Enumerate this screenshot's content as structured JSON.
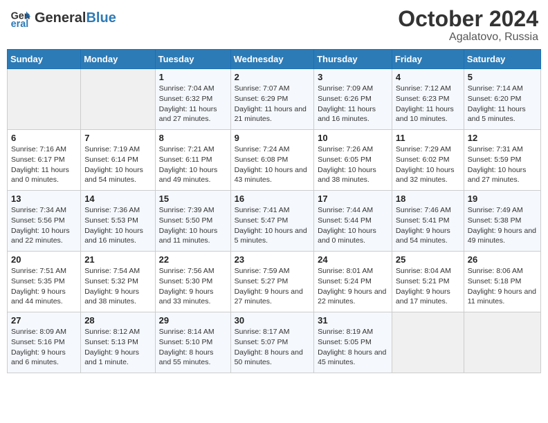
{
  "header": {
    "logo_line1": "General",
    "logo_line2": "Blue",
    "month": "October 2024",
    "location": "Agalatovo, Russia"
  },
  "days_of_week": [
    "Sunday",
    "Monday",
    "Tuesday",
    "Wednesday",
    "Thursday",
    "Friday",
    "Saturday"
  ],
  "weeks": [
    [
      {
        "num": "",
        "info": ""
      },
      {
        "num": "",
        "info": ""
      },
      {
        "num": "1",
        "info": "Sunrise: 7:04 AM\nSunset: 6:32 PM\nDaylight: 11 hours and 27 minutes."
      },
      {
        "num": "2",
        "info": "Sunrise: 7:07 AM\nSunset: 6:29 PM\nDaylight: 11 hours and 21 minutes."
      },
      {
        "num": "3",
        "info": "Sunrise: 7:09 AM\nSunset: 6:26 PM\nDaylight: 11 hours and 16 minutes."
      },
      {
        "num": "4",
        "info": "Sunrise: 7:12 AM\nSunset: 6:23 PM\nDaylight: 11 hours and 10 minutes."
      },
      {
        "num": "5",
        "info": "Sunrise: 7:14 AM\nSunset: 6:20 PM\nDaylight: 11 hours and 5 minutes."
      }
    ],
    [
      {
        "num": "6",
        "info": "Sunrise: 7:16 AM\nSunset: 6:17 PM\nDaylight: 11 hours and 0 minutes."
      },
      {
        "num": "7",
        "info": "Sunrise: 7:19 AM\nSunset: 6:14 PM\nDaylight: 10 hours and 54 minutes."
      },
      {
        "num": "8",
        "info": "Sunrise: 7:21 AM\nSunset: 6:11 PM\nDaylight: 10 hours and 49 minutes."
      },
      {
        "num": "9",
        "info": "Sunrise: 7:24 AM\nSunset: 6:08 PM\nDaylight: 10 hours and 43 minutes."
      },
      {
        "num": "10",
        "info": "Sunrise: 7:26 AM\nSunset: 6:05 PM\nDaylight: 10 hours and 38 minutes."
      },
      {
        "num": "11",
        "info": "Sunrise: 7:29 AM\nSunset: 6:02 PM\nDaylight: 10 hours and 32 minutes."
      },
      {
        "num": "12",
        "info": "Sunrise: 7:31 AM\nSunset: 5:59 PM\nDaylight: 10 hours and 27 minutes."
      }
    ],
    [
      {
        "num": "13",
        "info": "Sunrise: 7:34 AM\nSunset: 5:56 PM\nDaylight: 10 hours and 22 minutes."
      },
      {
        "num": "14",
        "info": "Sunrise: 7:36 AM\nSunset: 5:53 PM\nDaylight: 10 hours and 16 minutes."
      },
      {
        "num": "15",
        "info": "Sunrise: 7:39 AM\nSunset: 5:50 PM\nDaylight: 10 hours and 11 minutes."
      },
      {
        "num": "16",
        "info": "Sunrise: 7:41 AM\nSunset: 5:47 PM\nDaylight: 10 hours and 5 minutes."
      },
      {
        "num": "17",
        "info": "Sunrise: 7:44 AM\nSunset: 5:44 PM\nDaylight: 10 hours and 0 minutes."
      },
      {
        "num": "18",
        "info": "Sunrise: 7:46 AM\nSunset: 5:41 PM\nDaylight: 9 hours and 54 minutes."
      },
      {
        "num": "19",
        "info": "Sunrise: 7:49 AM\nSunset: 5:38 PM\nDaylight: 9 hours and 49 minutes."
      }
    ],
    [
      {
        "num": "20",
        "info": "Sunrise: 7:51 AM\nSunset: 5:35 PM\nDaylight: 9 hours and 44 minutes."
      },
      {
        "num": "21",
        "info": "Sunrise: 7:54 AM\nSunset: 5:32 PM\nDaylight: 9 hours and 38 minutes."
      },
      {
        "num": "22",
        "info": "Sunrise: 7:56 AM\nSunset: 5:30 PM\nDaylight: 9 hours and 33 minutes."
      },
      {
        "num": "23",
        "info": "Sunrise: 7:59 AM\nSunset: 5:27 PM\nDaylight: 9 hours and 27 minutes."
      },
      {
        "num": "24",
        "info": "Sunrise: 8:01 AM\nSunset: 5:24 PM\nDaylight: 9 hours and 22 minutes."
      },
      {
        "num": "25",
        "info": "Sunrise: 8:04 AM\nSunset: 5:21 PM\nDaylight: 9 hours and 17 minutes."
      },
      {
        "num": "26",
        "info": "Sunrise: 8:06 AM\nSunset: 5:18 PM\nDaylight: 9 hours and 11 minutes."
      }
    ],
    [
      {
        "num": "27",
        "info": "Sunrise: 8:09 AM\nSunset: 5:16 PM\nDaylight: 9 hours and 6 minutes."
      },
      {
        "num": "28",
        "info": "Sunrise: 8:12 AM\nSunset: 5:13 PM\nDaylight: 9 hours and 1 minute."
      },
      {
        "num": "29",
        "info": "Sunrise: 8:14 AM\nSunset: 5:10 PM\nDaylight: 8 hours and 55 minutes."
      },
      {
        "num": "30",
        "info": "Sunrise: 8:17 AM\nSunset: 5:07 PM\nDaylight: 8 hours and 50 minutes."
      },
      {
        "num": "31",
        "info": "Sunrise: 8:19 AM\nSunset: 5:05 PM\nDaylight: 8 hours and 45 minutes."
      },
      {
        "num": "",
        "info": ""
      },
      {
        "num": "",
        "info": ""
      }
    ]
  ]
}
